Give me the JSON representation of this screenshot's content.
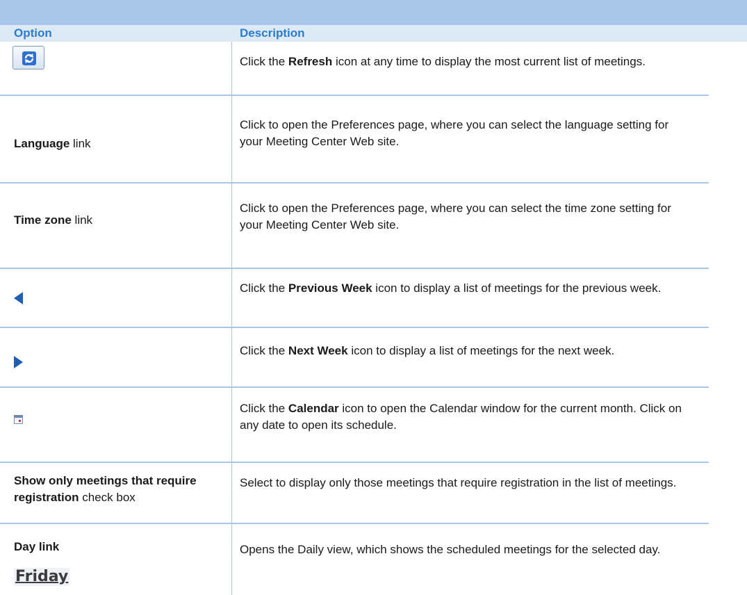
{
  "header": {
    "option": "Option",
    "description": "Description"
  },
  "rows": [
    {
      "option": {
        "icon": "refresh-icon"
      },
      "description": {
        "pre": "Click the ",
        "bold": "Refresh",
        "post": " icon at any time to display the most current list of meetings."
      }
    },
    {
      "option": {
        "bold": "Language",
        "post": " link"
      },
      "description": {
        "text": "Click to open the Preferences page, where you can select the language setting for your Meeting Center Web site."
      }
    },
    {
      "option": {
        "bold": "Time zone",
        "post": " link"
      },
      "description": {
        "text": "Click to open the Preferences page, where you can select the time zone setting for your Meeting Center Web site."
      }
    },
    {
      "option": {
        "icon": "previous-week-icon"
      },
      "description": {
        "pre": "Click the ",
        "bold": "Previous Week",
        "post": " icon to display a list of meetings for the previous week."
      }
    },
    {
      "option": {
        "icon": "next-week-icon"
      },
      "description": {
        "pre": "Click the ",
        "bold": "Next Week",
        "post": " icon to display a list of meetings for the next week."
      }
    },
    {
      "option": {
        "icon": "calendar-icon"
      },
      "description": {
        "pre": "Click the ",
        "bold": "Calendar",
        "post": " icon to open the Calendar window for the current month. Click on any date to open its schedule."
      }
    },
    {
      "option": {
        "bold": "Show only meetings that require registration",
        "post": " check box"
      },
      "description": {
        "text": "Select to display only those meetings that require registration in the list of meetings."
      }
    },
    {
      "option": {
        "bold": "Day link",
        "image_text": "Friday"
      },
      "description": {
        "text": "Opens the Daily view, which shows the scheduled meetings for the selected day."
      }
    }
  ],
  "colors": {
    "header_text": "#2a7bd4",
    "rule": "#a9c6e8",
    "icon_blue": "#1f5fb5"
  }
}
